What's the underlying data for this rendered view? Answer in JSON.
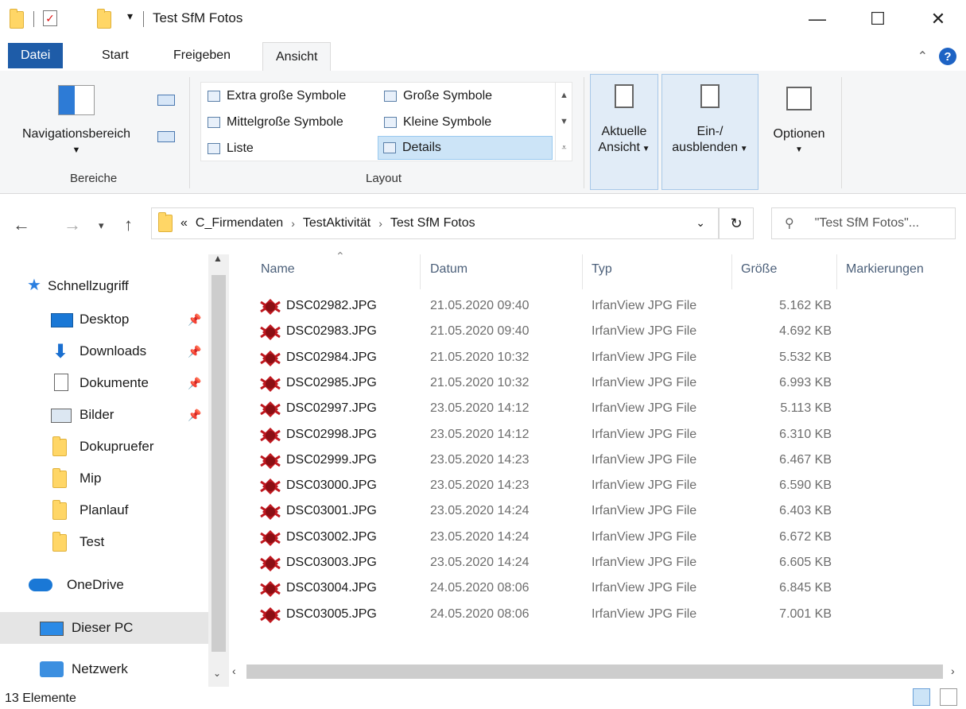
{
  "window": {
    "title": "Test SfM Fotos",
    "minimize": "—",
    "maximize": "☐",
    "close": "✕"
  },
  "tabs": [
    {
      "label": "Datei"
    },
    {
      "label": "Start"
    },
    {
      "label": "Freigeben"
    },
    {
      "label": "Ansicht"
    }
  ],
  "ribbon": {
    "nav_pane": "Navigationsbereich",
    "group_bereiche": "Bereiche",
    "group_layout": "Layout",
    "layout_items": [
      {
        "label": "Extra große Symbole"
      },
      {
        "label": "Große Symbole"
      },
      {
        "label": "Mittelgroße Symbole"
      },
      {
        "label": "Kleine Symbole"
      },
      {
        "label": "Liste"
      },
      {
        "label": "Details"
      }
    ],
    "current_view_1": "Aktuelle",
    "current_view_2": "Ansicht",
    "show_hide_1": "Ein-/",
    "show_hide_2": "ausblenden",
    "options": "Optionen"
  },
  "address": {
    "prefix": "«",
    "crumbs": [
      "C_Firmendaten",
      "TestAktivität",
      "Test SfM Fotos"
    ],
    "search_placeholder": "\"Test SfM Fotos\"..."
  },
  "sidebar": {
    "quick_access": "Schnellzugriff",
    "items": [
      {
        "label": "Desktop",
        "pinned": true
      },
      {
        "label": "Downloads",
        "pinned": true
      },
      {
        "label": "Dokumente",
        "pinned": true
      },
      {
        "label": "Bilder",
        "pinned": true
      },
      {
        "label": "Dokupruefer",
        "pinned": false
      },
      {
        "label": "Mip",
        "pinned": false
      },
      {
        "label": "Planlauf",
        "pinned": false
      },
      {
        "label": "Test",
        "pinned": false
      }
    ],
    "onedrive": "OneDrive",
    "this_pc": "Dieser PC",
    "network": "Netzwerk"
  },
  "columns": {
    "name": "Name",
    "date": "Datum",
    "type": "Typ",
    "size": "Größe",
    "tags": "Markierungen"
  },
  "files": [
    {
      "name": "DSC02982.JPG",
      "date": "21.05.2020 09:40",
      "type": "IrfanView JPG File",
      "size": "5.162 KB"
    },
    {
      "name": "DSC02983.JPG",
      "date": "21.05.2020 09:40",
      "type": "IrfanView JPG File",
      "size": "4.692 KB"
    },
    {
      "name": "DSC02984.JPG",
      "date": "21.05.2020 10:32",
      "type": "IrfanView JPG File",
      "size": "5.532 KB"
    },
    {
      "name": "DSC02985.JPG",
      "date": "21.05.2020 10:32",
      "type": "IrfanView JPG File",
      "size": "6.993 KB"
    },
    {
      "name": "DSC02997.JPG",
      "date": "23.05.2020 14:12",
      "type": "IrfanView JPG File",
      "size": "5.113 KB"
    },
    {
      "name": "DSC02998.JPG",
      "date": "23.05.2020 14:12",
      "type": "IrfanView JPG File",
      "size": "6.310 KB"
    },
    {
      "name": "DSC02999.JPG",
      "date": "23.05.2020 14:23",
      "type": "IrfanView JPG File",
      "size": "6.467 KB"
    },
    {
      "name": "DSC03000.JPG",
      "date": "23.05.2020 14:23",
      "type": "IrfanView JPG File",
      "size": "6.590 KB"
    },
    {
      "name": "DSC03001.JPG",
      "date": "23.05.2020 14:24",
      "type": "IrfanView JPG File",
      "size": "6.403 KB"
    },
    {
      "name": "DSC03002.JPG",
      "date": "23.05.2020 14:24",
      "type": "IrfanView JPG File",
      "size": "6.672 KB"
    },
    {
      "name": "DSC03003.JPG",
      "date": "23.05.2020 14:24",
      "type": "IrfanView JPG File",
      "size": "6.605 KB"
    },
    {
      "name": "DSC03004.JPG",
      "date": "24.05.2020 08:06",
      "type": "IrfanView JPG File",
      "size": "6.845 KB"
    },
    {
      "name": "DSC03005.JPG",
      "date": "24.05.2020 08:06",
      "type": "IrfanView JPG File",
      "size": "7.001 KB"
    }
  ],
  "status": {
    "count": "13 Elemente"
  },
  "colors": {
    "accent": "#1e5ca8",
    "selection": "#cce4f7",
    "folder": "#ffd666"
  }
}
